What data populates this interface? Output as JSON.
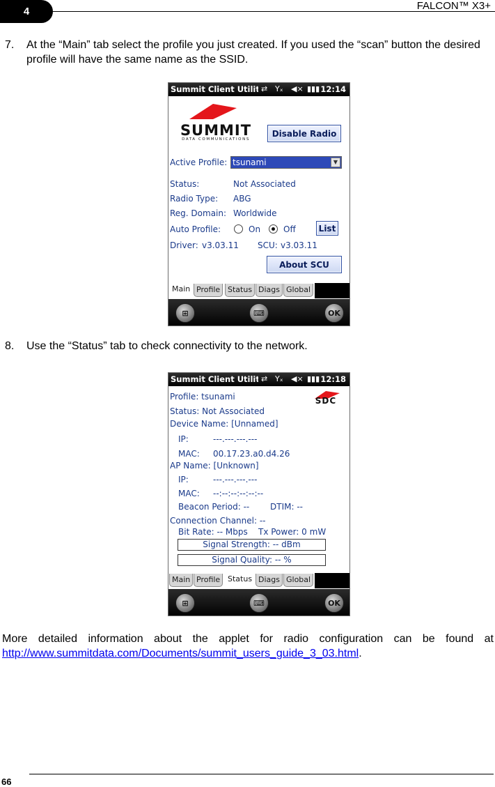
{
  "header": {
    "chapter": "4",
    "product": "FALCON™ X3+"
  },
  "steps": [
    {
      "number": "7.",
      "text": "At the “Main” tab select the profile you just created. If you used the “scan” button the desired profile will have the same name as the SSID."
    },
    {
      "number": "8.",
      "text": "Use the “Status” tab to check connectivity to the network."
    }
  ],
  "closing": {
    "text": "More detailed information about the applet for radio configuration can be found at",
    "link": "http://www.summitdata.com/Documents/summit_users_guide_3_03.html",
    "end": "."
  },
  "footer": {
    "page_number": "66"
  },
  "screen_main": {
    "title": "Summit Client Utility",
    "time": "12:14",
    "logo": {
      "word": "SUMMIT",
      "tagline": "DATA COMMUNICATIONS"
    },
    "disable_radio": "Disable Radio",
    "active_profile_label": "Active Profile:",
    "active_profile_value": "tsunami",
    "status_label": "Status:",
    "status_value": "Not Associated",
    "radio_type_label": "Radio Type:",
    "radio_type_value": "ABG",
    "reg_domain_label": "Reg. Domain:",
    "reg_domain_value": "Worldwide",
    "auto_profile_label": "Auto Profile:",
    "on_label": "On",
    "off_label": "Off",
    "list_button": "List",
    "driver_label": "Driver:",
    "driver_value": "v3.03.11",
    "scu_label": "SCU:",
    "scu_value": "v3.03.11",
    "about_button": "About SCU",
    "tabs": [
      "Main",
      "Profile",
      "Status",
      "Diags",
      "Global"
    ],
    "active_tab": "Main",
    "softkey_ok": "OK"
  },
  "screen_status": {
    "title": "Summit Client Utility",
    "time": "12:18",
    "logo": "SDC",
    "profile": "Profile: tsunami",
    "status": "Status: Not Associated",
    "device_name": "Device Name: [Unnamed]",
    "ip_label": "IP:",
    "ip_value": "---.---.---.---",
    "mac_label": "MAC:",
    "mac_value": "00.17.23.a0.d4.26",
    "ap_name": "AP Name:  [Unknown]",
    "ap_ip_label": "IP:",
    "ap_ip_value": "---.---.---.---",
    "ap_mac_label": "MAC:",
    "ap_mac_value": "--:--:--:--:--:--",
    "beacon": "Beacon Period: --",
    "dtim": "DTIM: --",
    "channel": "Connection Channel:   --",
    "bitrate": "Bit Rate: -- Mbps",
    "txpower": "Tx Power:  0 mW",
    "signal_strength": "Signal Strength: -- dBm",
    "signal_quality": "Signal Quality: -- %",
    "tabs": [
      "Main",
      "Profile",
      "Status",
      "Diags",
      "Global"
    ],
    "active_tab": "Status",
    "softkey_ok": "OK"
  }
}
